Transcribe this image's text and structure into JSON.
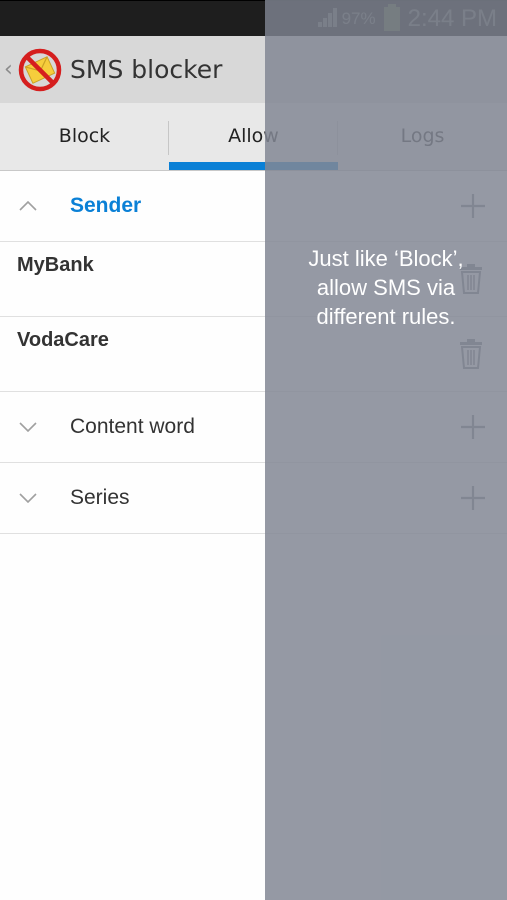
{
  "status_bar": {
    "battery_percent": "97%",
    "time": "2:44 PM",
    "battery_color": "#b6e27c"
  },
  "action_bar": {
    "title": "SMS blocker",
    "icon": "no-sms-envelope-icon"
  },
  "tabs": [
    {
      "label": "Block",
      "active": false
    },
    {
      "label": "Allow",
      "active": true
    },
    {
      "label": "Logs",
      "active": false
    }
  ],
  "accent_color": "#0a80d6",
  "groups": [
    {
      "label": "Sender",
      "expanded": true,
      "items": [
        {
          "name": "MyBank"
        },
        {
          "name": "VodaCare"
        }
      ]
    },
    {
      "label": "Content word",
      "expanded": false,
      "items": []
    },
    {
      "label": "Series",
      "expanded": false,
      "items": []
    }
  ],
  "overlay": {
    "line1": "Just like ‘Block’,",
    "line2": "allow SMS via",
    "line3": "different rules."
  }
}
